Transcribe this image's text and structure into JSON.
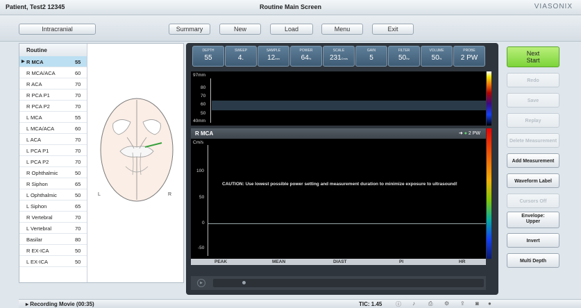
{
  "title_bar": {
    "patient": "Patient, Test2   12345",
    "screen": "Routine Main Screen",
    "brand": "VIASONIX"
  },
  "nav": {
    "intracranial": "Intracranial",
    "summary": "Summary",
    "new": "New",
    "load": "Load",
    "menu": "Menu",
    "exit": "Exit"
  },
  "routine": {
    "header": "Routine",
    "items": [
      {
        "name": "R MCA",
        "depth": "55"
      },
      {
        "name": "R MCA/ACA",
        "depth": "60"
      },
      {
        "name": "R ACA",
        "depth": "70"
      },
      {
        "name": "R PCA P1",
        "depth": "70"
      },
      {
        "name": "R PCA P2",
        "depth": "70"
      },
      {
        "name": "L MCA",
        "depth": "55"
      },
      {
        "name": "L MCA/ACA",
        "depth": "60"
      },
      {
        "name": "L ACA",
        "depth": "70"
      },
      {
        "name": "L PCA P1",
        "depth": "70"
      },
      {
        "name": "L PCA P2",
        "depth": "70"
      },
      {
        "name": "R Ophthalmic",
        "depth": "50"
      },
      {
        "name": "R Siphon",
        "depth": "65"
      },
      {
        "name": "L Ophthalmic",
        "depth": "50"
      },
      {
        "name": "L Siphon",
        "depth": "65"
      },
      {
        "name": "R Vertebral",
        "depth": "70"
      },
      {
        "name": "L Vertebral",
        "depth": "70"
      },
      {
        "name": "Basilar",
        "depth": "80"
      },
      {
        "name": "R EX-ICA",
        "depth": "50"
      },
      {
        "name": "L EX-ICA",
        "depth": "50"
      }
    ]
  },
  "brain": {
    "left_label": "L",
    "right_label": "R"
  },
  "params": [
    {
      "label": "DEPTH",
      "value": "55",
      "unit": ""
    },
    {
      "label": "SWEEP",
      "value": "4.",
      "unit": ""
    },
    {
      "label": "SAMPLE",
      "value": "12",
      "unit": "mm"
    },
    {
      "label": "POWER",
      "value": "64",
      "unit": "%"
    },
    {
      "label": "SCALE",
      "value": "231",
      "unit": "Cm/s"
    },
    {
      "label": "GAIN",
      "value": "5",
      "unit": ""
    },
    {
      "label": "FILTER",
      "value": "50",
      "unit": "Hz"
    },
    {
      "label": "VOLUME",
      "value": "50",
      "unit": "%"
    },
    {
      "label": "PROBE",
      "value": "2 PW",
      "unit": ""
    }
  ],
  "mmode": {
    "top": "97mm",
    "t80": "80",
    "t70": "70",
    "t60": "60",
    "t50": "50",
    "bottom": "40mm"
  },
  "spectral": {
    "vessel": "R MCA",
    "mode": "2 PW",
    "unit": "Cm/s",
    "t100": "100",
    "t50": "50",
    "t0": "0",
    "tm50": "-50",
    "caution": "CAUTION: Use lowest possible power setting and measurement duration to minimize exposure to ultrasound!"
  },
  "measurements": {
    "peak": "PEAK",
    "mean": "MEAN",
    "diast": "DIAST",
    "pi": "PI",
    "hr": "HR"
  },
  "actions": {
    "next_line1": "Next",
    "next_line2": "Start",
    "redo": "Redo",
    "save": "Save",
    "replay": "Replay",
    "delete_measurement": "Delete Measurement",
    "add_measurement": "Add Measurement",
    "waveform_label": "Waveform Label",
    "cursors_off": "Cursors Off",
    "envelope_line1": "Envelope:",
    "envelope_line2": "Upper",
    "invert": "Invert",
    "multi_depth": "Multi Depth"
  },
  "status": {
    "recording": "Recording Movie (00:35)",
    "tic": "TIC: 1.45"
  },
  "colors": {
    "accent_green": "#7cd43a",
    "active_row": "#bcdff2",
    "vessel_highlight": "#37a13c"
  }
}
